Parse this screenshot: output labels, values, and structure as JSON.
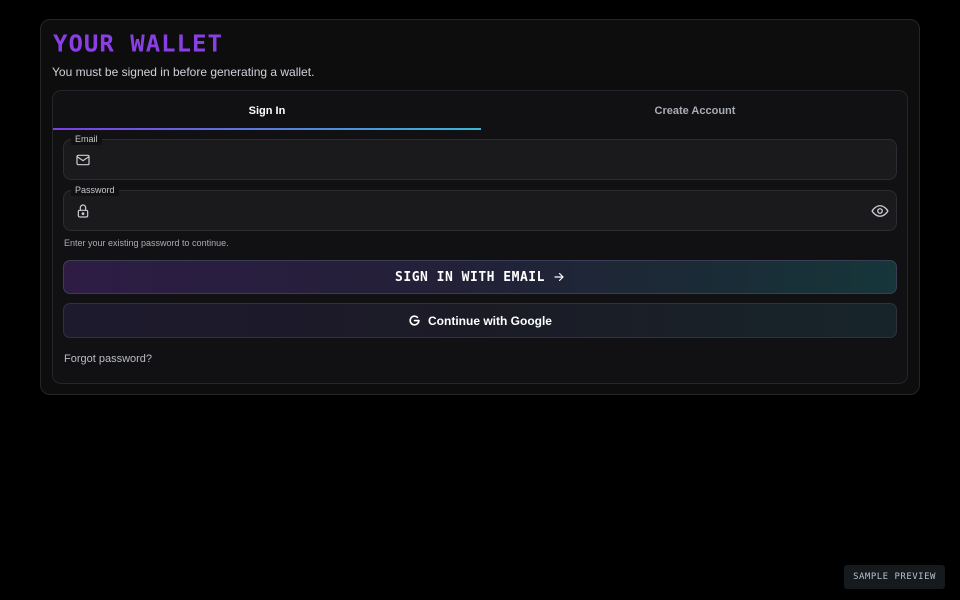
{
  "wallet": {
    "title": "YOUR WALLET",
    "subtitle": "You must be signed in before generating a wallet."
  },
  "tabs": [
    {
      "label": "Sign In",
      "active": true
    },
    {
      "label": "Create Account",
      "active": false
    }
  ],
  "form": {
    "email": {
      "label": "Email",
      "value": "",
      "placeholder": "",
      "icon": "mail-icon"
    },
    "password": {
      "label": "Password",
      "value": "",
      "placeholder": "",
      "icon": "lock-icon",
      "toggle_icon": "eye-icon"
    },
    "hint": "Enter your existing password to continue.",
    "sign_in_label": "SIGN IN WITH EMAIL",
    "google_label": "Continue with Google",
    "forgot_label": "Forgot password?"
  },
  "badge": "SAMPLE PREVIEW",
  "colors": {
    "accent_purple": "#8a3fe6",
    "accent_cyan": "#38b8d6",
    "background": "#000000"
  }
}
